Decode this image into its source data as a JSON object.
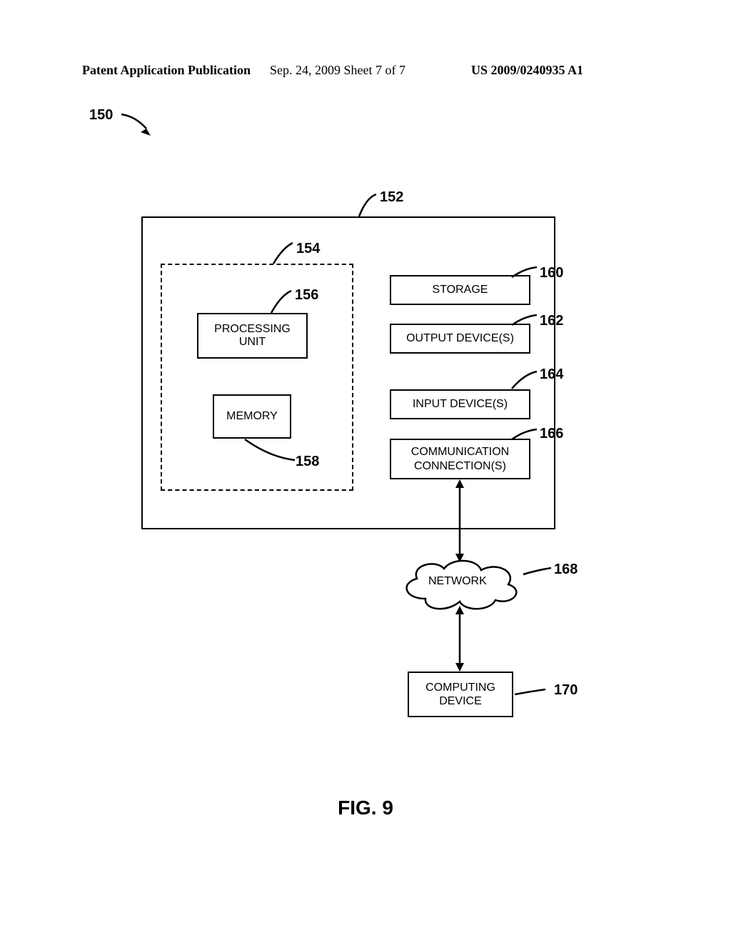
{
  "header": {
    "left": "Patent Application Publication",
    "mid": "Sep. 24, 2009  Sheet 7 of 7",
    "right": "US 2009/0240935 A1"
  },
  "refs": {
    "r150": "150",
    "r152": "152",
    "r154": "154",
    "r156": "156",
    "r158": "158",
    "r160": "160",
    "r162": "162",
    "r164": "164",
    "r166": "166",
    "r168": "168",
    "r170": "170"
  },
  "boxes": {
    "processing": "PROCESSING\nUNIT",
    "memory": "MEMORY",
    "storage": "STORAGE",
    "output": "OUTPUT DEVICE(S)",
    "input": "INPUT DEVICE(S)",
    "comm": "COMMUNICATION\nCONNECTION(S)",
    "network": "NETWORK",
    "compdev": "COMPUTING\nDEVICE"
  },
  "figure": "FIG. 9"
}
